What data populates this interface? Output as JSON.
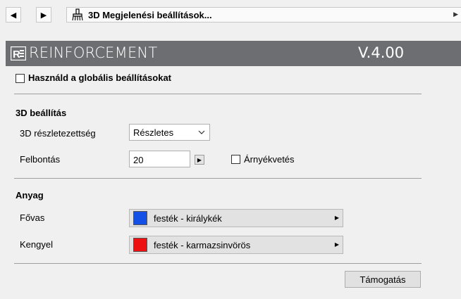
{
  "toolbar": {
    "back_glyph": "◀",
    "forward_glyph": "▶",
    "title_icon": "brush-icon",
    "title": "3D Megjelenési beállítások...",
    "expand_glyph": "▶"
  },
  "header": {
    "logo": "reinforcement-logo",
    "brand": "REINFORCEMENT",
    "version": "V.4.00",
    "background_color": "#6c6e72"
  },
  "global_settings": {
    "label": "Használd a globális beállításokat",
    "checked": false
  },
  "section_3d": {
    "title": "3D beállítás",
    "detail": {
      "label": "3D részletezettség",
      "selected": "Részletes"
    },
    "resolution": {
      "label": "Felbontás",
      "value": "20",
      "stepper_glyph": "▶"
    },
    "shadow": {
      "label": "Árnyékvetés",
      "checked": false
    }
  },
  "section_material": {
    "title": "Anyag",
    "items": [
      {
        "label": "Fővas",
        "material": "festék - királykék",
        "color": "#1450e6",
        "arrow": "▶"
      },
      {
        "label": "Kengyel",
        "material": "festék - karmazsinvörös",
        "color": "#ee1111",
        "arrow": "▶"
      }
    ]
  },
  "support_button": "Támogatás"
}
